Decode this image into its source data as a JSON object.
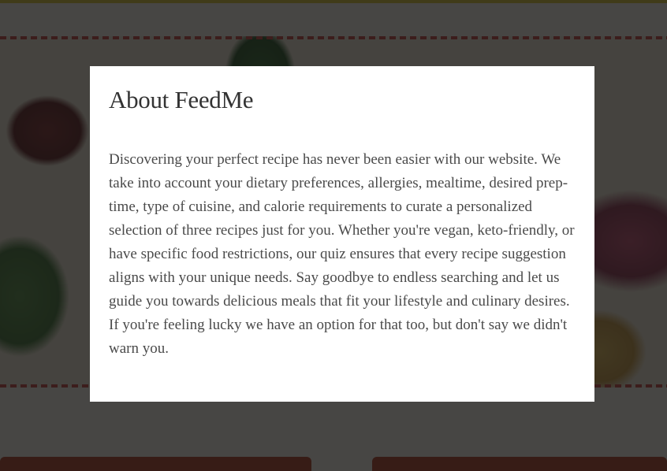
{
  "modal": {
    "title": "About FeedMe",
    "body": "Discovering your perfect recipe has never been easier with our website. We take into account your dietary preferences, allergies, mealtime, desired prep-time, type of cuisine, and calorie requirements to curate a personalized selection of three recipes just for you. Whether you're vegan, keto-friendly, or have specific food restrictions, our quiz ensures that every recipe suggestion aligns with your unique needs. Say goodbye to endless searching and let us guide you towards delicious meals that fit your lifestyle and culinary desires. If you're feeling lucky we have an option for that too, but don't say we didn't warn you."
  },
  "colors": {
    "overlay": "#141414",
    "modal_background": "#ffffff",
    "title_text": "#333333",
    "body_text": "#4a4a4a",
    "accent_yellow": "#d8c42a",
    "dash_red": "#c83c3a",
    "card_red": "#b03a1e"
  }
}
